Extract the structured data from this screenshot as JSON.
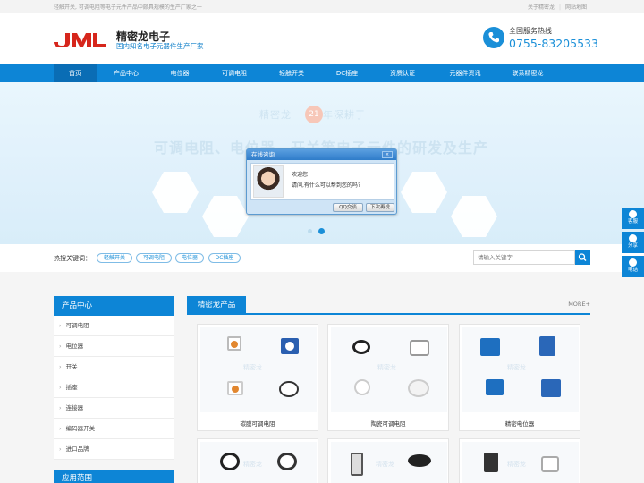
{
  "topbar": {
    "tagline": "轻触开关, 可调电阻等电子元件产品中颇具规模的生产厂家之一",
    "links": [
      "关于精密龙",
      "网站地图"
    ]
  },
  "header": {
    "brand_name": "精密龙电子",
    "brand_sub": "国内知名电子元器件生产厂家",
    "hotline_label": "全国服务热线",
    "hotline_number": "0755-83205533"
  },
  "nav": {
    "items": [
      "首页",
      "产品中心",
      "电位器",
      "可调电阻",
      "轻触开关",
      "DC插座",
      "资质认证",
      "元器件资讯",
      "联系精密龙"
    ]
  },
  "banner": {
    "tag_line_left": "精密龙",
    "tag_num": "21",
    "tag_line_right": "年深耕于",
    "headline": "可调电阻、电位器、开关等电子元件的研发及生产"
  },
  "chat": {
    "title": "在线咨询",
    "line1": "欢迎您！",
    "line2": "请问,有什么可以帮到您的吗?",
    "btn_qq": "QQ交谈",
    "btn_later": "下次再说"
  },
  "search": {
    "hot_label": "热搜关键词：",
    "hot_tags": [
      "轻触开关",
      "可调电阻",
      "电位器",
      "DC插座"
    ],
    "placeholder": "请输入关键字"
  },
  "sidebar": {
    "title": "产品中心",
    "items": [
      "可调电阻",
      "电位器",
      "开关",
      "插座",
      "连接器",
      "编码器开关",
      "进口品牌"
    ],
    "title2": "应用范围"
  },
  "main": {
    "tab": "精密龙产品",
    "more": "MORE+",
    "products": [
      "碳膜可调电阻",
      "陶瓷可调电阻",
      "精密电位器"
    ]
  },
  "float": {
    "items": [
      "客服",
      "分享",
      "电话"
    ]
  },
  "colors": {
    "primary": "#0d85d6",
    "logo_red": "#d6261c"
  }
}
